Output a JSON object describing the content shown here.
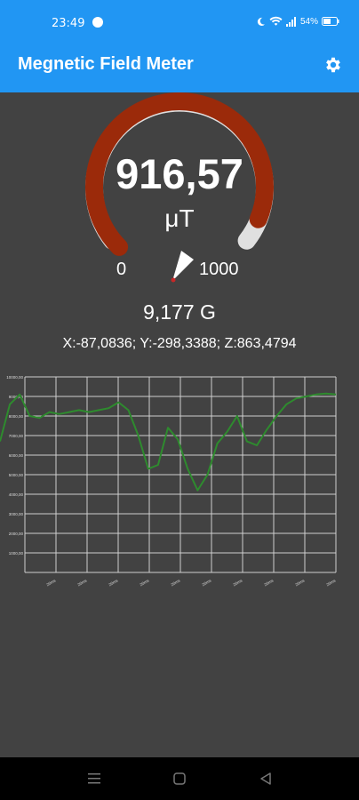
{
  "status": {
    "time": "23:49",
    "battery": "54%"
  },
  "app_bar": {
    "title": "Megnetic Field Meter"
  },
  "gauge": {
    "value": "916,57",
    "unit": "μT",
    "min_label": "0",
    "max_label": "1000",
    "level": 0.9166,
    "colors": {
      "active": "#9b2a0a",
      "inactive": "#e0e0e0"
    }
  },
  "readings": {
    "gauss": "9,177 G",
    "xyz": "X:-87,0836;  Y:-298,3388;  Z:863,4794"
  },
  "chart_data": {
    "type": "line",
    "ylim": [
      0,
      10000
    ],
    "y_ticks": [
      "10000,00",
      "9000,00",
      "8000,00",
      "7000,00",
      "6000,00",
      "5000,00",
      "4000,00",
      "3000,00",
      "2000,00",
      "1000,00"
    ],
    "x_ticks": [
      "20ms",
      "20ms",
      "20ms",
      "20ms",
      "20ms",
      "20ms",
      "20ms",
      "20ms",
      "20ms",
      "20ms"
    ],
    "series": [
      {
        "color": "#2e8b2e",
        "values": [
          6700,
          8600,
          9100,
          8000,
          7900,
          8200,
          8100,
          8200,
          8300,
          8200,
          8300,
          8400,
          8700,
          8300,
          7000,
          5300,
          5500,
          7400,
          6800,
          5300,
          4200,
          5000,
          6600,
          7200,
          8000,
          6700,
          6500,
          7300,
          8000,
          8600,
          8900,
          9000,
          9100,
          9150,
          9100
        ]
      }
    ]
  },
  "nav": {
    "buttons": [
      "menu",
      "home",
      "back"
    ]
  }
}
